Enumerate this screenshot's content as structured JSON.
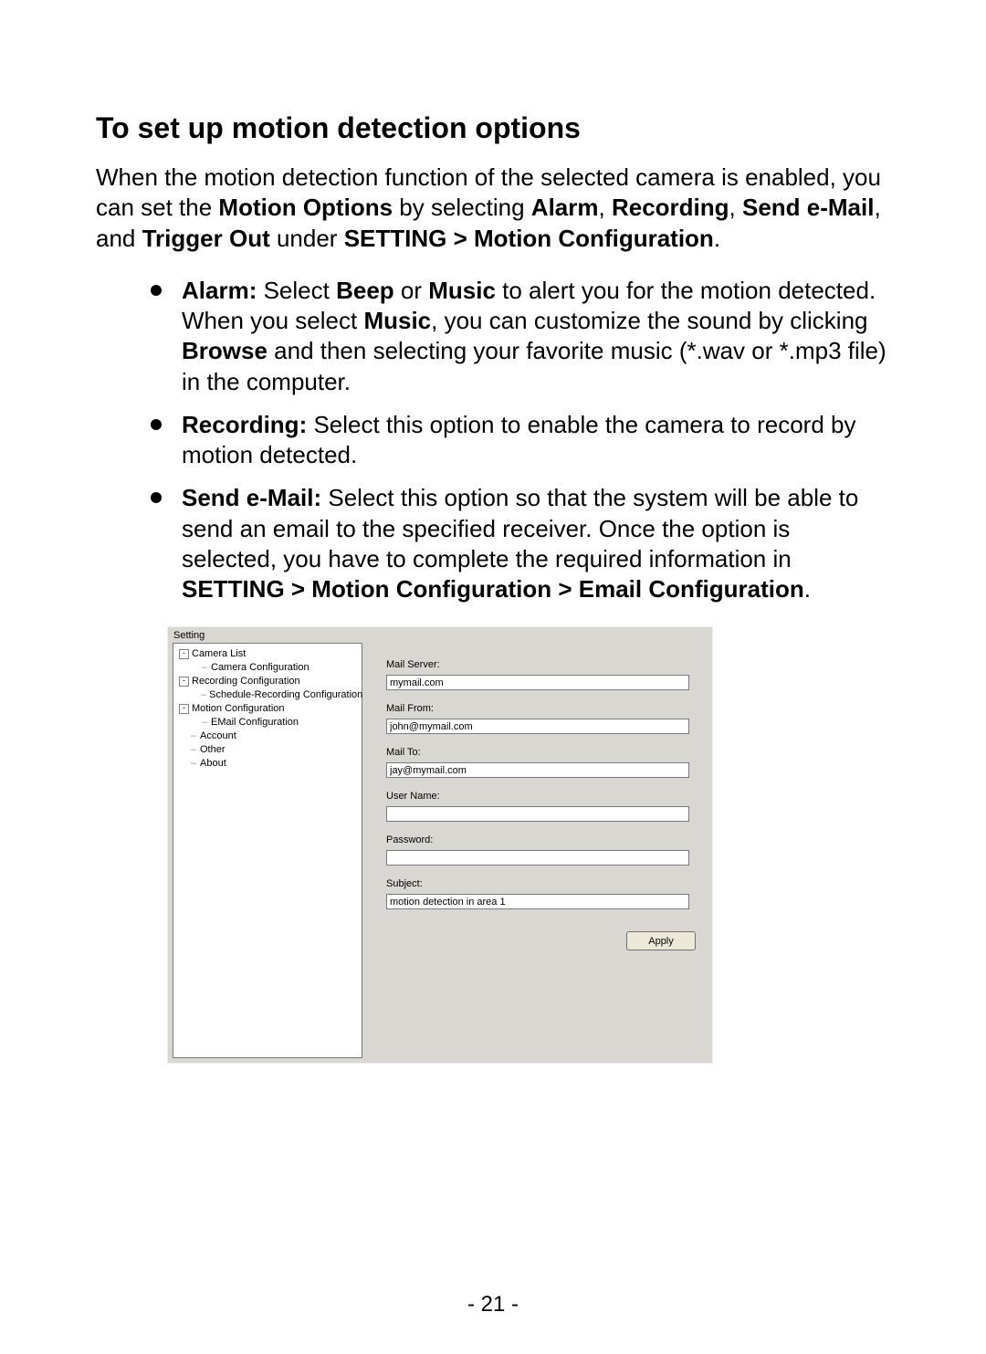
{
  "title": "To set up motion detection options",
  "intro_parts": {
    "p1": "When the motion detection function of the selected camera is enabled, you can set the ",
    "b1": "Motion Options",
    "p2": " by selecting ",
    "b2": "Alarm",
    "p3": ", ",
    "b3": "Recording",
    "p4": ", ",
    "b4": "Send e-Mail",
    "p5": ", and ",
    "b5": "Trigger Out",
    "p6": " under ",
    "b6": "SETTING > Motion Configuration",
    "p7": "."
  },
  "bullets": {
    "alarm": {
      "lead": "Alarm:",
      "t1": " Select ",
      "b1": "Beep",
      "t2": " or ",
      "b2": "Music",
      "t3": " to alert you for the motion detected. When you select ",
      "b3": "Music",
      "t4": ", you can customize the sound by clicking ",
      "b4": "Browse",
      "t5": " and then selecting your favorite music (*.wav or *.mp3 file) in the computer."
    },
    "recording": {
      "lead": "Recording:",
      "t1": " Select this option to enable the camera to record by motion detected."
    },
    "email": {
      "lead": "Send e-Mail:",
      "t1": " Select this option so that the system will be able to send an email to the specified receiver. Once the option is selected, you have to complete the required information in ",
      "b1": "SETTING > Motion Configuration > Email Configuration",
      "t2": "."
    }
  },
  "panel": {
    "header": "Setting",
    "tree": {
      "camera_list": "Camera List",
      "camera_config": "Camera Configuration",
      "recording_config": "Recording Configuration",
      "schedule_rec_config": "Schedule-Recording Configuration",
      "motion_config": "Motion Configuration",
      "email_config": "EMail Configuration",
      "account": "Account",
      "other": "Other",
      "about": "About",
      "minus": "-"
    },
    "form": {
      "mail_server_label": "Mail Server:",
      "mail_server_value": "mymail.com",
      "mail_from_label": "Mail From:",
      "mail_from_value": "john@mymail.com",
      "mail_to_label": "Mail To:",
      "mail_to_value": "jay@mymail.com",
      "user_name_label": "User Name:",
      "user_name_value": "",
      "password_label": "Password:",
      "password_value": "",
      "subject_label": "Subject:",
      "subject_value": "motion detection in area 1",
      "apply": "Apply"
    }
  },
  "page_number": "- 21 -"
}
